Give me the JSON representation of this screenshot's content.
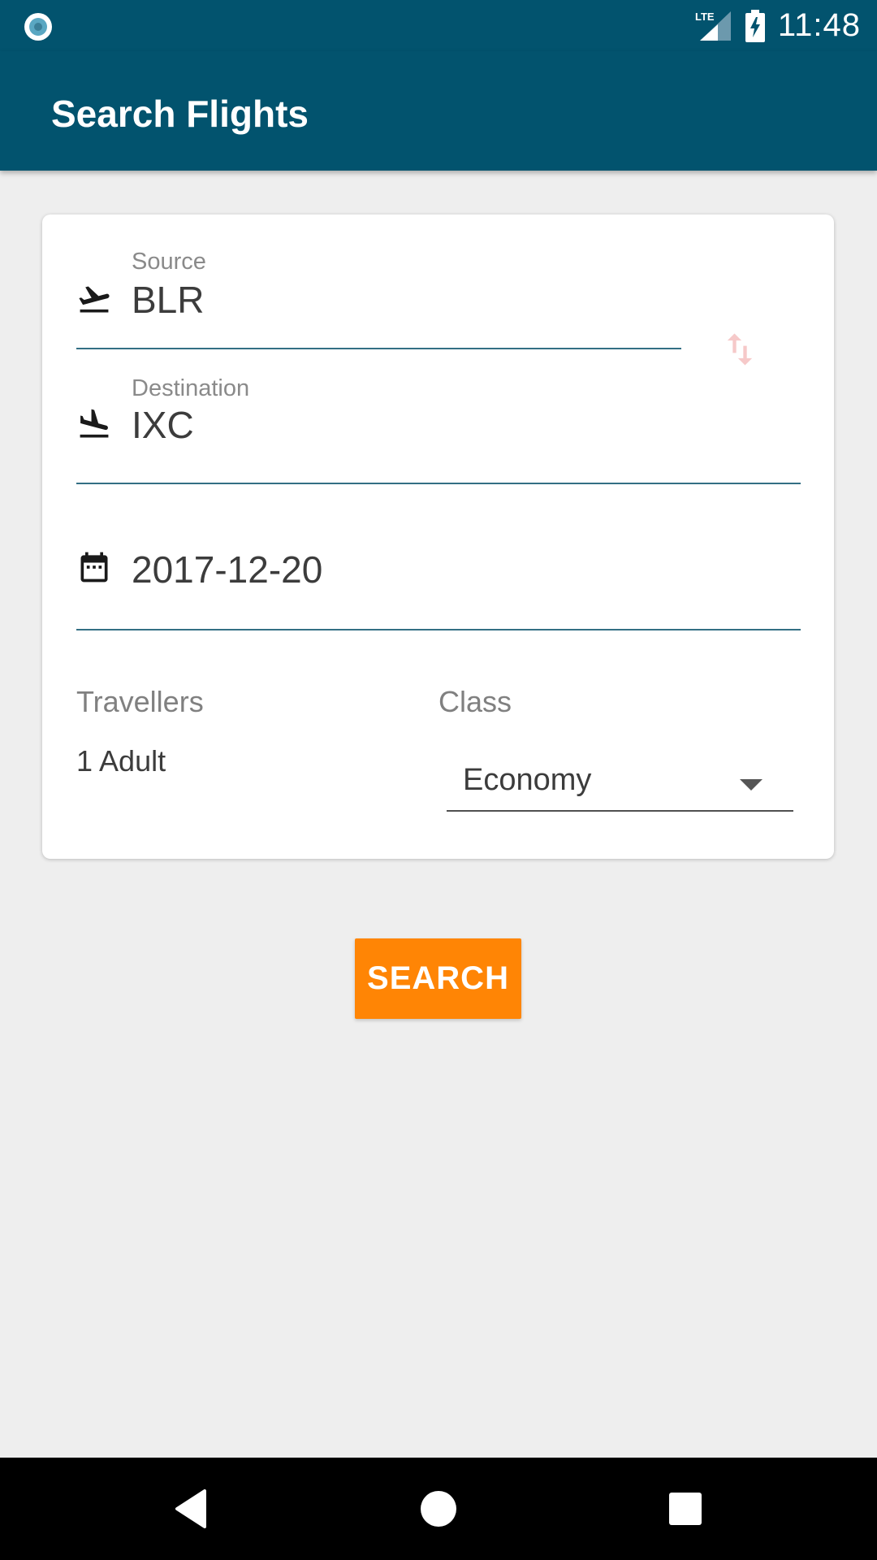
{
  "status_bar": {
    "network_label": "LTE",
    "time": "11:48",
    "icons": [
      "app-notification-icon",
      "signal-icon",
      "battery-charging-icon"
    ]
  },
  "app_bar": {
    "title": "Search Flights"
  },
  "form": {
    "source": {
      "label": "Source",
      "value": "BLR",
      "icon": "flight-takeoff-icon"
    },
    "destination": {
      "label": "Destination",
      "value": "IXC",
      "icon": "flight-landing-icon"
    },
    "swap_icon": "swap-vert-icon",
    "date": {
      "value": "2017-12-20",
      "icon": "calendar-icon"
    },
    "travellers": {
      "label": "Travellers",
      "value": "1 Adult"
    },
    "class": {
      "label": "Class",
      "value": "Economy",
      "icon": "arrow-drop-down-icon"
    }
  },
  "search_button": {
    "label": "SEARCH"
  },
  "nav": {
    "icons": [
      "back-icon",
      "home-icon",
      "recents-icon"
    ]
  },
  "colors": {
    "primary": "#02536e",
    "accent": "#ff8505",
    "background": "#eeeeee",
    "underline": "#336f84"
  }
}
